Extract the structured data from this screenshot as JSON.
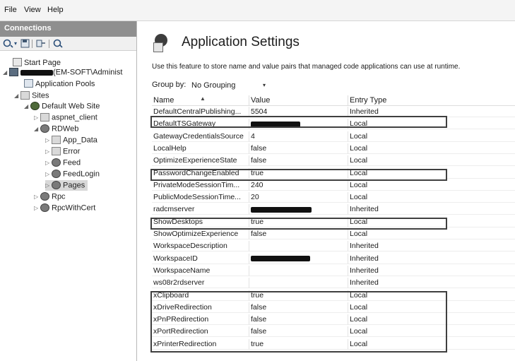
{
  "menubar": {
    "file": "File",
    "view": "View",
    "help": "Help"
  },
  "connections": {
    "header": "Connections",
    "tree": {
      "start_page": "Start Page",
      "server_suffix": "(EM-SOFT\\Administ",
      "app_pools": "Application Pools",
      "sites": "Sites",
      "default_site": "Default Web Site",
      "aspnet_client": "aspnet_client",
      "rdweb": "RDWeb",
      "app_data": "App_Data",
      "error": "Error",
      "feed": "Feed",
      "feedlogin": "FeedLogin",
      "pages": "Pages",
      "rpc": "Rpc",
      "rpcwithcert": "RpcWithCert"
    }
  },
  "main": {
    "title": "Application Settings",
    "description": "Use this feature to store name and value pairs that managed code applications can use at runtime.",
    "group_by_label": "Group by:",
    "group_by_value": "No Grouping",
    "columns": {
      "name": "Name",
      "value": "Value",
      "type": "Entry Type"
    },
    "rows": [
      {
        "name": "DefaultCentralPublishing...",
        "value": "5504",
        "type": "Inherited",
        "redacted": false
      },
      {
        "name": "DefaultTSGateway",
        "value": "",
        "type": "Local",
        "redacted": true
      },
      {
        "name": "GatewayCredentialsSource",
        "value": "4",
        "type": "Local",
        "redacted": false
      },
      {
        "name": "LocalHelp",
        "value": "false",
        "type": "Local",
        "redacted": false
      },
      {
        "name": "OptimizeExperienceState",
        "value": "false",
        "type": "Local",
        "redacted": false
      },
      {
        "name": "PasswordChangeEnabled",
        "value": "true",
        "type": "Local",
        "redacted": false
      },
      {
        "name": "PrivateModeSessionTim...",
        "value": "240",
        "type": "Local",
        "redacted": false
      },
      {
        "name": "PublicModeSessionTime...",
        "value": "20",
        "type": "Local",
        "redacted": false
      },
      {
        "name": "radcmserver",
        "value": "",
        "type": "Inherited",
        "redacted": true
      },
      {
        "name": "ShowDesktops",
        "value": "true",
        "type": "Local",
        "redacted": false
      },
      {
        "name": "ShowOptimizeExperience",
        "value": "false",
        "type": "Local",
        "redacted": false
      },
      {
        "name": "WorkspaceDescription",
        "value": "",
        "type": "Inherited",
        "redacted": false
      },
      {
        "name": "WorkspaceID",
        "value": "",
        "type": "Inherited",
        "redacted": true
      },
      {
        "name": "WorkspaceName",
        "value": "",
        "type": "Inherited",
        "redacted": false
      },
      {
        "name": "ws08r2rdserver",
        "value": "",
        "type": "Inherited",
        "redacted": false
      },
      {
        "name": "xClipboard",
        "value": "true",
        "type": "Local",
        "redacted": false
      },
      {
        "name": "xDriveRedirection",
        "value": "false",
        "type": "Local",
        "redacted": false
      },
      {
        "name": "xPnPRedirection",
        "value": "false",
        "type": "Local",
        "redacted": false
      },
      {
        "name": "xPortRedirection",
        "value": "false",
        "type": "Local",
        "redacted": false
      },
      {
        "name": "xPrinterRedirection",
        "value": "true",
        "type": "Local",
        "redacted": false
      }
    ]
  },
  "icons": {
    "back": "back-arrow-icon",
    "save": "save-icon",
    "connect": "connect-icon",
    "refresh": "refresh-icon",
    "sort": "sort-ascending-icon",
    "dropdown": "chevron-down-icon"
  }
}
